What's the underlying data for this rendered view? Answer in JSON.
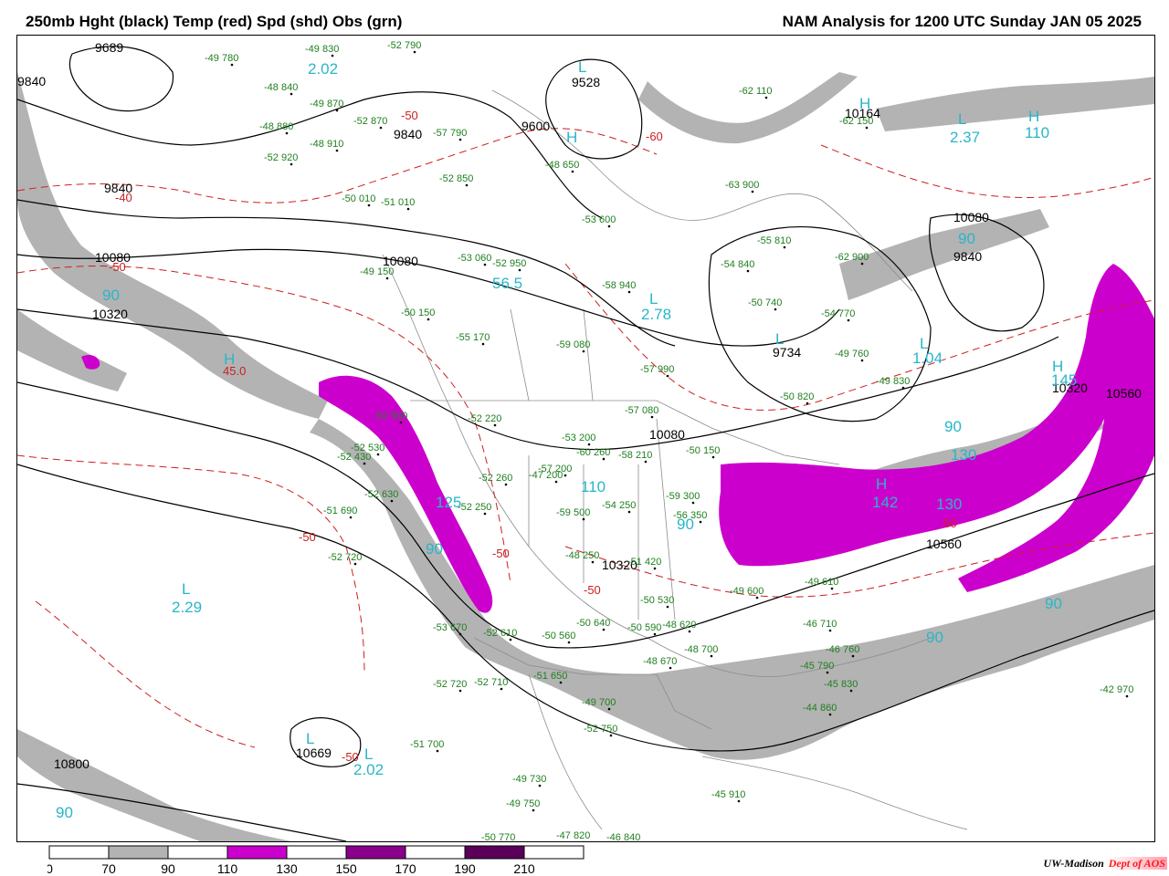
{
  "header": {
    "title_left": "250mb Hght (black) Temp (red) Spd (shd) Obs (grn)",
    "title_right": "NAM Analysis for 1200 UTC Sunday  JAN 05 2025"
  },
  "credit": {
    "org": "UW-Madison",
    "dept": "Dept of AOS"
  },
  "colors": {
    "height_contour": "#000000",
    "temperature_contour": "#cc1f1f",
    "speed_70_90": "#b3b3b3",
    "speed_110_130": "#cc00cc",
    "speed_150_170": "#8a008a",
    "speed_190_210": "#5a005a",
    "obs_text": "#1f7f1f",
    "center_label": "#29b6c8",
    "border_lines": "#8c8c8c"
  },
  "legend": {
    "ticks": [
      "0",
      "70",
      "90",
      "110",
      "130",
      "150",
      "170",
      "190",
      "210"
    ],
    "fills": [
      "#ffffff",
      "#b3b3b3",
      "#ffffff",
      "#cc00cc",
      "#ffffff",
      "#8a008a",
      "#ffffff",
      "#5a005a",
      "#ffffff"
    ]
  },
  "height_labels": [
    "9689",
    "9840",
    "9840",
    "9840",
    "10080",
    "10080",
    "10320",
    "9600",
    "9528",
    "10164",
    "10080",
    "9840",
    "9734",
    "10080",
    "10320",
    "10560",
    "10560",
    "10320",
    "10669",
    "10800"
  ],
  "temp_labels": [
    "-40",
    "-50",
    "-50",
    "-60",
    "-50",
    "45.0",
    "-50",
    "-50",
    "-50",
    "-50"
  ],
  "speed_labels": [
    "90",
    "90",
    "90",
    "90",
    "130",
    "110",
    "130",
    "145",
    "110",
    "90",
    "90",
    "90",
    "90",
    "2.02",
    "2.37",
    "2.78",
    "1.04",
    "2.29",
    "2.02",
    "56.5",
    "142",
    "125"
  ],
  "centers": [
    "H",
    "L",
    "L",
    "L",
    "H",
    "L",
    "L",
    "H",
    "H",
    "L",
    "H",
    "L",
    "L",
    "H"
  ],
  "observations": [
    "-49 780",
    "-49 830",
    "-52 790",
    "-48 840",
    "-49 870",
    "-48 880",
    "-52 870",
    "-48 910",
    "-52 920",
    "-57 790",
    "-48 650",
    "-52 850",
    "-50 010",
    "-51 010",
    "-53 600",
    "-53 060",
    "-52 950",
    "-58 940",
    "-54 840",
    "-55 810",
    "-62 900",
    "-50 740",
    "-54 770",
    "-63 900",
    "-62 110",
    "-62 150",
    "-49 150",
    "-50 150",
    "-55 170",
    "-59 080",
    "-57 990",
    "-49 760",
    "-49 830",
    "-50 820",
    "-52 220",
    "-57 080",
    "-53 200",
    "-60 260",
    "-57 200",
    "-58 210",
    "-50 150",
    "-52 260",
    "-59 500",
    "-54 250",
    "-59 300",
    "-56 350",
    "-52 530",
    "-52 630",
    "-51 690",
    "-52 720",
    "-51 420",
    "-48 250",
    "-50 530",
    "-48 620",
    "-49 600",
    "-49 610",
    "-53 670",
    "-52 610",
    "-50 560",
    "-50 640",
    "-50 590",
    "-48 670",
    "-48 700",
    "-46 710",
    "-46 760",
    "-45 790",
    "-45 830",
    "-44 860",
    "-42 970",
    "-52 720",
    "-52 710",
    "-51 650",
    "-49 700",
    "-52 750",
    "-51 700",
    "-49 730",
    "-49 750",
    "-50 770",
    "-47 820",
    "-46 840",
    "-45 910",
    "-47 200",
    "-52 500",
    "-52 430",
    "-52 250"
  ]
}
